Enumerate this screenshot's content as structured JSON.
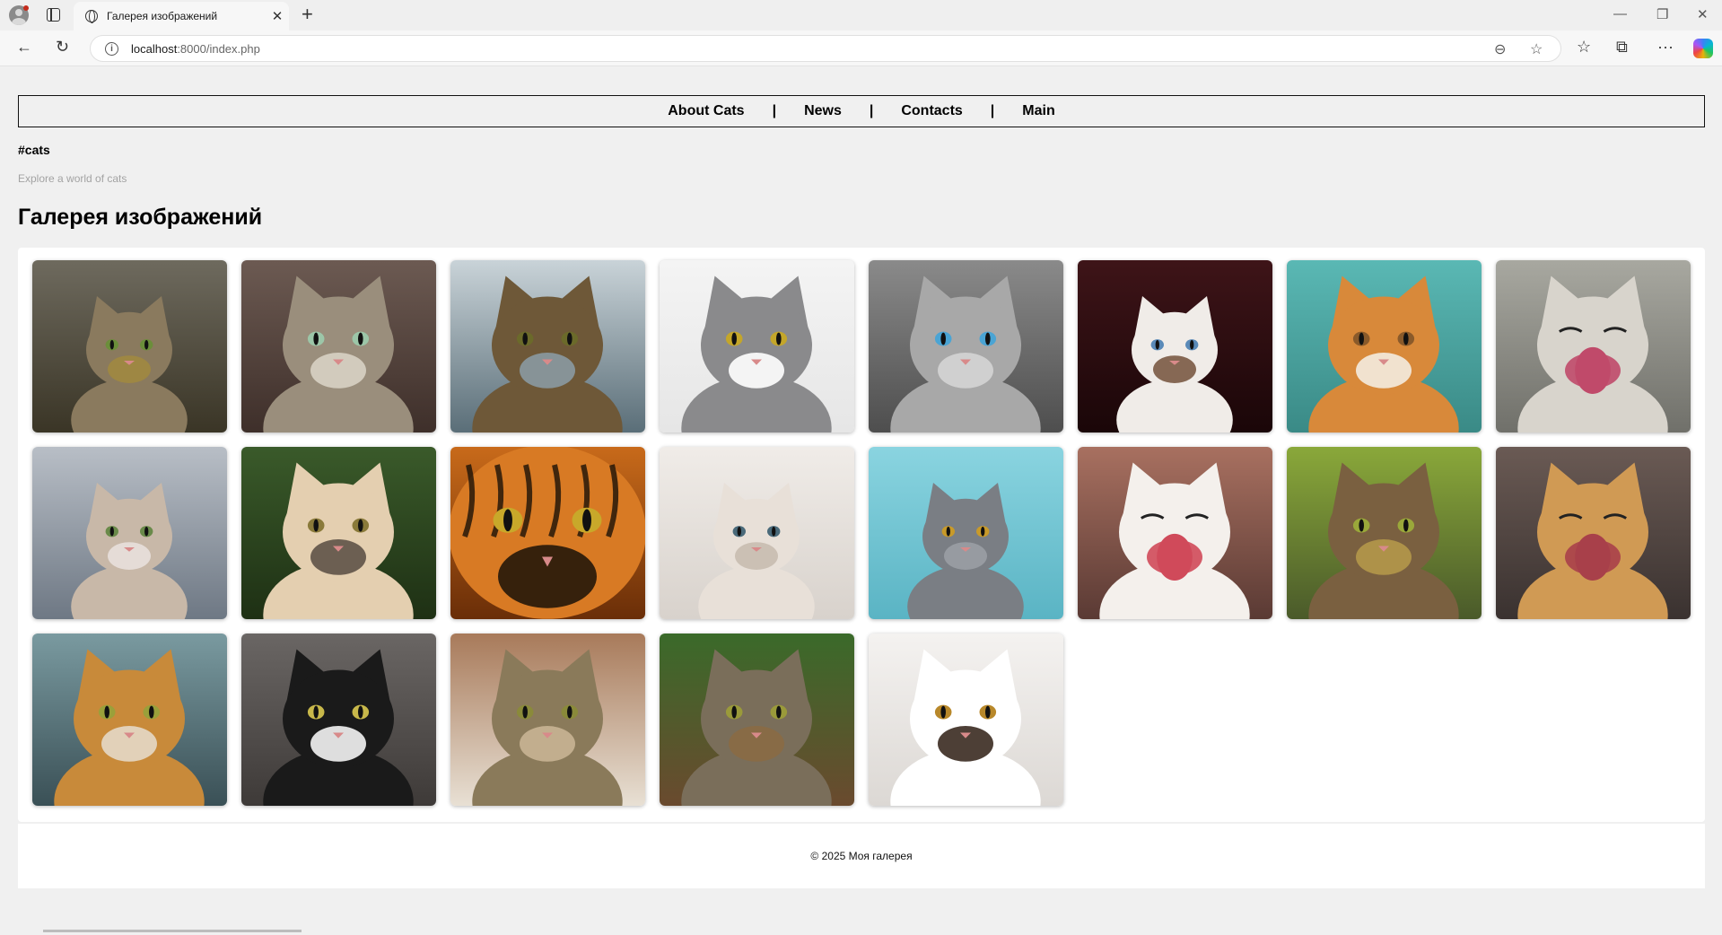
{
  "browser": {
    "tab_title": "Галерея изображений",
    "url_host": "localhost",
    "url_path": ":8000/index.php"
  },
  "nav": {
    "items": [
      "About Cats",
      "News",
      "Contacts",
      "Main"
    ],
    "separator": "|"
  },
  "header": {
    "brand": "#cats",
    "tagline": "Explore a world of cats"
  },
  "gallery": {
    "title": "Галерея изображений",
    "images": [
      {
        "name": "tabby-kitten-on-sofa",
        "subject": "kitten",
        "bg": [
          "#6e6a5e",
          "#3a3526"
        ],
        "fur": "#8a7a5e",
        "eyes": "#6b8e3a",
        "accent": "#a08840"
      },
      {
        "name": "tabby-cat-green-eyes",
        "subject": "cat",
        "bg": [
          "#6c5a52",
          "#3e2f2a"
        ],
        "fur": "#9a8e7c",
        "eyes": "#9cc6a8",
        "accent": "#d8d2c4"
      },
      {
        "name": "cat-by-sea",
        "subject": "cat",
        "bg": [
          "#c9d3d8",
          "#5a6e78"
        ],
        "fur": "#6e5838",
        "eyes": "#6b6a2a",
        "accent": "#8a9aa2"
      },
      {
        "name": "grey-white-cat",
        "subject": "cat",
        "bg": [
          "#f4f4f4",
          "#e6e6e6"
        ],
        "fur": "#8a8a8c",
        "eyes": "#c4a62a",
        "accent": "#ffffff"
      },
      {
        "name": "grey-cat-blue-eyes",
        "subject": "cat",
        "bg": [
          "#8a8a8a",
          "#4e4e4e"
        ],
        "fur": "#a8a8a8",
        "eyes": "#4aa4d4",
        "accent": "#d4d4d4"
      },
      {
        "name": "white-kitten-dark-bg",
        "subject": "kitten",
        "bg": [
          "#3e1418",
          "#1a0608"
        ],
        "fur": "#f0ece8",
        "eyes": "#5a8ab8",
        "accent": "#7a5a44"
      },
      {
        "name": "orange-cat-licking",
        "subject": "cat",
        "bg": [
          "#5ab8b4",
          "#3a8a86"
        ],
        "fur": "#d8893a",
        "eyes": "#8a5a2a",
        "accent": "#f4ece0"
      },
      {
        "name": "yawning-cat",
        "subject": "yawn",
        "bg": [
          "#a8a8a0",
          "#70706a"
        ],
        "fur": "#d8d4cc",
        "eyes": "#8a6a3a",
        "accent": "#c04a6a"
      },
      {
        "name": "kitten-on-pillows",
        "subject": "kitten",
        "bg": [
          "#b8bec6",
          "#6e7884"
        ],
        "fur": "#c8b8a8",
        "eyes": "#6a8a4a",
        "accent": "#e8e0dc"
      },
      {
        "name": "cat-under-bench",
        "subject": "cat",
        "bg": [
          "#3a5a2a",
          "#1e3014"
        ],
        "fur": "#e4cfb0",
        "eyes": "#8a7a3a",
        "accent": "#5e5248"
      },
      {
        "name": "tiger-face",
        "subject": "tiger",
        "bg": [
          "#c86a1a",
          "#6a2e08"
        ],
        "fur": "#d87a24",
        "eyes": "#c8a82a",
        "accent": "#1a1208"
      },
      {
        "name": "fluffy-white-kitten",
        "subject": "kitten",
        "bg": [
          "#f0ece8",
          "#d8d2cc"
        ],
        "fur": "#e8e0d8",
        "eyes": "#4a6a7a",
        "accent": "#c8bcb0"
      },
      {
        "name": "grey-british-kitten",
        "subject": "kitten",
        "bg": [
          "#8ad4e0",
          "#5ab4c4"
        ],
        "fur": "#7a7e84",
        "eyes": "#c89a2a",
        "accent": "#9a9ea4"
      },
      {
        "name": "yawning-white-kitten",
        "subject": "yawn",
        "bg": [
          "#a87060",
          "#5a3a34"
        ],
        "fur": "#f4f0ec",
        "eyes": "#3a3030",
        "accent": "#d04a5a"
      },
      {
        "name": "stretching-tabby",
        "subject": "cat",
        "bg": [
          "#8aa83a",
          "#4a5a2a"
        ],
        "fur": "#7a6040",
        "eyes": "#9aa83a",
        "accent": "#b4984a"
      },
      {
        "name": "yawning-ginger-cat",
        "subject": "yawn",
        "bg": [
          "#6a5a54",
          "#3a3230"
        ],
        "fur": "#d09a54",
        "eyes": "#8a6a2a",
        "accent": "#a8404a"
      },
      {
        "name": "fluffy-ginger-cat",
        "subject": "cat",
        "bg": [
          "#7a9aa0",
          "#3a5056"
        ],
        "fur": "#c88a3a",
        "eyes": "#9aa03a",
        "accent": "#e4d8c8"
      },
      {
        "name": "black-white-cat",
        "subject": "cat",
        "bg": [
          "#6a6664",
          "#3e3a38"
        ],
        "fur": "#1a1a1a",
        "eyes": "#c8b84a",
        "accent": "#f4f4f4"
      },
      {
        "name": "resting-tabby",
        "subject": "cat",
        "bg": [
          "#a87a5a",
          "#e8e0d4"
        ],
        "fur": "#8a7a5a",
        "eyes": "#8a8a3a",
        "accent": "#c8b494"
      },
      {
        "name": "cat-on-fence",
        "subject": "cat",
        "bg": [
          "#3a6a2a",
          "#6a4a2e"
        ],
        "fur": "#7a6e5a",
        "eyes": "#9a9a3a",
        "accent": "#8a6a44"
      },
      {
        "name": "calico-cat-lying",
        "subject": "cat",
        "bg": [
          "#f4f2f0",
          "#dcd8d4"
        ],
        "fur": "#ffffff",
        "eyes": "#b8882a",
        "accent": "#3a2a20"
      }
    ]
  },
  "footer": {
    "text": "© 2025 Моя галерея"
  },
  "colors": {
    "page_bg": "#f0f0f0",
    "card_bg": "#ffffff",
    "tagline": "#a3a3a3",
    "nav_border": "#111111"
  }
}
